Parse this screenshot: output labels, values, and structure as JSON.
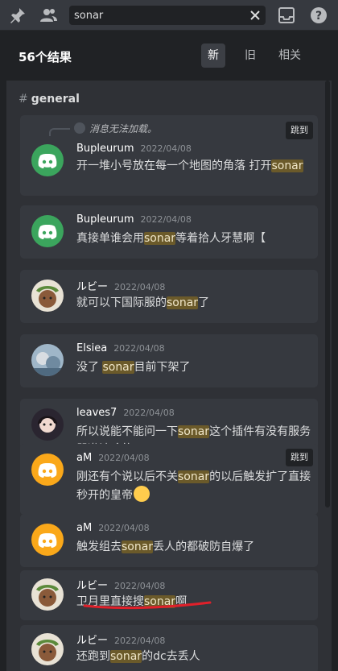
{
  "toolbar": {
    "icons": [
      "pin-icon",
      "members-icon",
      "inbox-icon",
      "help-icon"
    ],
    "search": {
      "value": "sonar",
      "placeholder": ""
    }
  },
  "results": {
    "count_label": "56个结果",
    "sort_tabs": [
      {
        "label": "新",
        "active": true
      },
      {
        "label": "旧",
        "active": false
      },
      {
        "label": "相关",
        "active": false
      }
    ],
    "channel": "general",
    "jump_label": "跳到",
    "reply_unavailable": "消息无法加载。"
  },
  "messages": [
    {
      "author": "Bupleurum",
      "time": "2022/04/08",
      "avatar": "discord-logo-green",
      "parts": [
        [
          "开一堆小号放在每一个地图的角落 打开",
          false
        ],
        [
          "sonar",
          true
        ]
      ]
    },
    {
      "author": "Bupleurum",
      "time": "2022/04/08",
      "avatar": "discord-logo-green",
      "parts": [
        [
          "真接单谁会用",
          false
        ],
        [
          "sonar",
          true
        ],
        [
          "等着拾人牙慧啊【",
          false
        ]
      ]
    },
    {
      "author": "ルビー",
      "time": "2022/04/08",
      "avatar": "anime-avatar-brown",
      "parts": [
        [
          "就可以下国际服的",
          false
        ],
        [
          "sonar",
          true
        ],
        [
          "了",
          false
        ]
      ]
    },
    {
      "author": "Elsiea",
      "time": "2022/04/08",
      "avatar": "photo-avatar-blue",
      "parts": [
        [
          "没了 ",
          false
        ],
        [
          "sonar",
          true
        ],
        [
          "目前下架了",
          false
        ]
      ]
    },
    {
      "author": "leaves7",
      "time": "2022/04/08",
      "avatar": "anime-avatar-dark",
      "parts": [
        [
          "所以说能不能问一下",
          false
        ],
        [
          "sonar",
          true
        ],
        [
          "这个插件有没有服务器邀请啥的",
          false
        ]
      ]
    },
    {
      "author": "aM",
      "time": "2022/04/08",
      "avatar": "discord-logo-yellow",
      "parts": [
        [
          "刚还有个说以后不关",
          false
        ],
        [
          "sonar",
          true
        ],
        [
          "的以后触发扩了直接秒开的皇帝",
          false
        ]
      ]
    },
    {
      "author": "aM",
      "time": "2022/04/08",
      "avatar": "discord-logo-yellow",
      "parts": [
        [
          "触发组去",
          false
        ],
        [
          "sonar",
          true
        ],
        [
          "丢人的都破防自爆了",
          false
        ]
      ]
    },
    {
      "author": "ルビー",
      "time": "2022/04/08",
      "avatar": "anime-avatar-brown",
      "parts": [
        [
          "卫月里直接搜",
          false
        ],
        [
          "sonar",
          true
        ],
        [
          "啊",
          false
        ]
      ]
    },
    {
      "author": "ルビー",
      "time": "2022/04/08",
      "avatar": "anime-avatar-brown",
      "parts": [
        [
          "还跑到",
          false
        ],
        [
          "sonar",
          true
        ],
        [
          "的dc去丢人",
          false
        ]
      ]
    }
  ]
}
